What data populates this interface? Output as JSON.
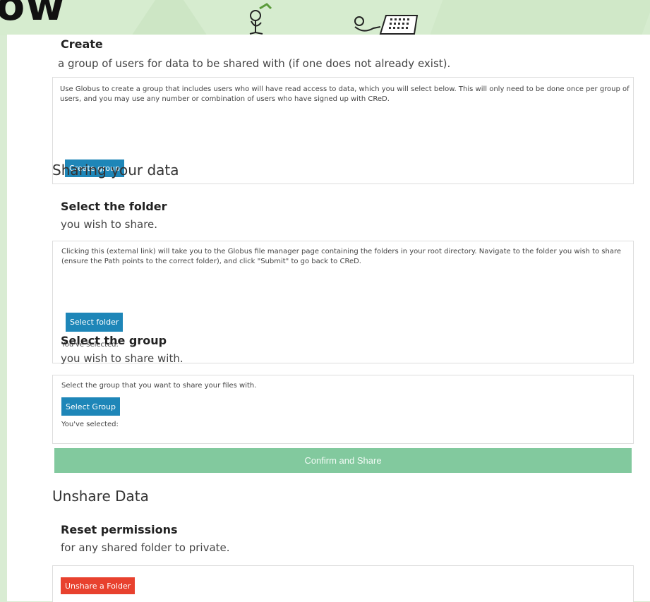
{
  "header": {
    "big_word": "ow"
  },
  "create_step": {
    "title": "Create",
    "subtitle": "a group of users for data to be shared with (if one does not already exist).",
    "description": "Use Globus to create a group that includes users who will have read access to data, which you will select below. This will only need to be done once per group of users, and you may use any number or combination of users who have signed up with CReD.",
    "button_label": "Create group"
  },
  "sharing_section": {
    "heading": "Sharing your data"
  },
  "folder_step": {
    "title": "Select the folder",
    "subtitle": "you wish to share.",
    "description": "Clicking this (external link) will take you to the Globus file manager page containing the folders in your root directory. Navigate to the folder you wish to share (ensure the Path points to the correct folder), and click \"Submit\" to go back to CReD.",
    "button_label": "Select folder",
    "selected_label": "You've selected:"
  },
  "group_step": {
    "title": "Select the group",
    "subtitle": "you wish to share with.",
    "description": "Select the group that you want to share your files with.",
    "button_label": "Select Group",
    "selected_label": "You've selected:"
  },
  "confirm_button_label": "Confirm and Share",
  "unshare_section": {
    "heading": "Unshare Data"
  },
  "reset_step": {
    "title": "Reset permissions",
    "subtitle": "for any shared folder to private.",
    "button_label": "Unshare a Folder"
  },
  "colors": {
    "background": "#d9ecd3",
    "primary_button": "#1e86b8",
    "confirm_button": "#82c99e",
    "danger_button": "#e8412e"
  }
}
